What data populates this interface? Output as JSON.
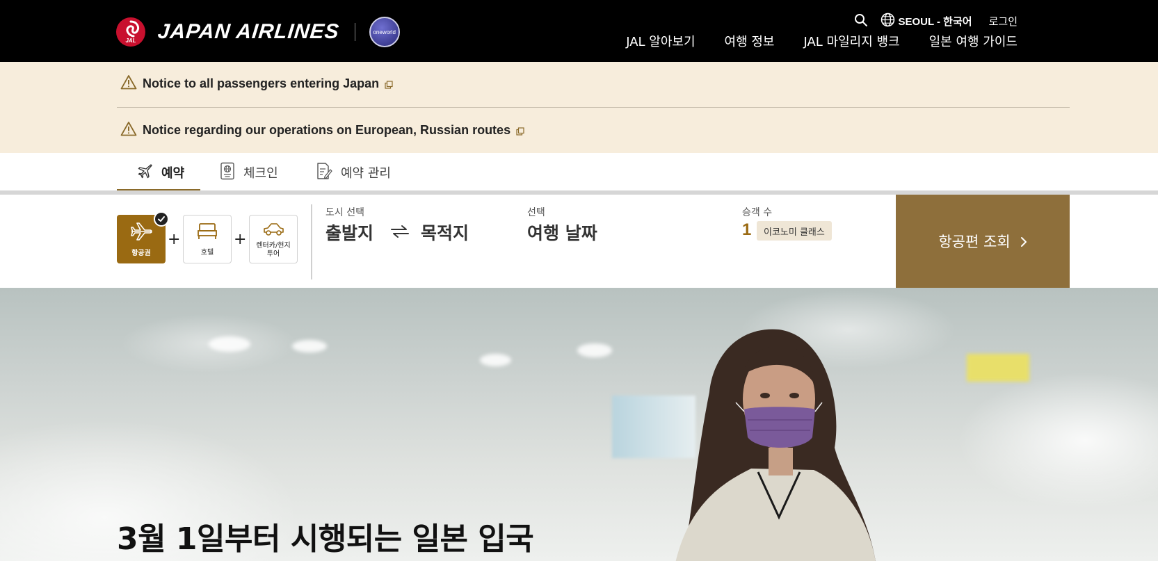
{
  "brand": {
    "logo_mark_text": "JAL",
    "name": "JAPAN AIRLINES",
    "alliance": "oneworld"
  },
  "utility": {
    "region": "SEOUL - 한국어",
    "login": "로그인"
  },
  "nav": {
    "items": [
      "JAL 알아보기",
      "여행 정보",
      "JAL 마일리지 뱅크",
      "일본 여행 가이드"
    ]
  },
  "notices": [
    {
      "text": "Notice to all passengers entering Japan"
    },
    {
      "text": "Notice regarding our operations on European, Russian routes"
    }
  ],
  "tabs": [
    {
      "label": "예약",
      "active": true,
      "icon": "airplane-icon"
    },
    {
      "label": "체크인",
      "active": false,
      "icon": "passport-icon"
    },
    {
      "label": "예약 관리",
      "active": false,
      "icon": "document-edit-icon"
    }
  ],
  "booking": {
    "products": [
      {
        "label": "항공권",
        "selected": true,
        "icon": "airplane-icon"
      },
      {
        "label": "호텔",
        "selected": false,
        "icon": "bed-icon"
      },
      {
        "label_line1": "렌터카/현지",
        "label_line2": "투어",
        "selected": false,
        "icon": "car-icon"
      }
    ],
    "city": {
      "label": "도시 선택",
      "origin": "출발지",
      "destination": "목적지"
    },
    "date": {
      "label": "선택",
      "value": "여행 날짜"
    },
    "passengers": {
      "label": "승객 수",
      "count": "1",
      "cabin": "이코노미 클래스"
    },
    "search_button": "항공편 조회"
  },
  "hero": {
    "title": "3월 1일부터 시행되는 일본 입국"
  },
  "colors": {
    "header_bg": "#000000",
    "notice_bg": "#f7eddc",
    "gold": "#9a6a12",
    "search_button_bg": "#8e6f3b",
    "jal_red": "#c8102e"
  }
}
